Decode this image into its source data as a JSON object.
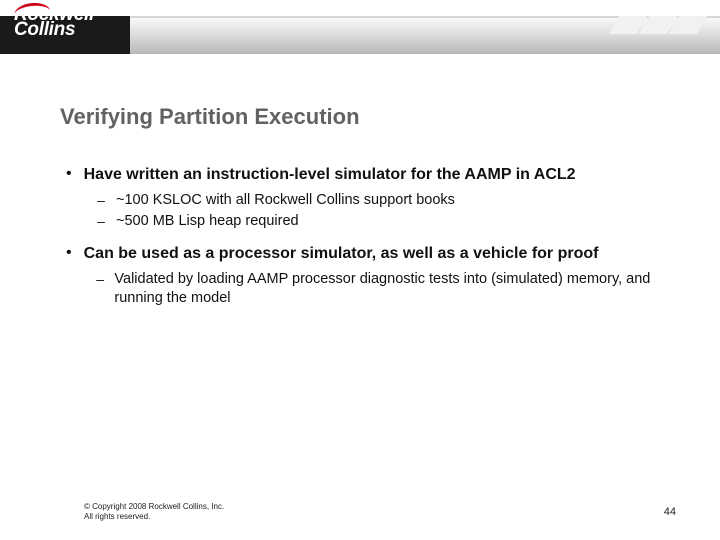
{
  "brand": {
    "name_top": "Rockwell",
    "name_bottom": "Collins",
    "registered": "®"
  },
  "slide": {
    "title": "Verifying Partition Execution",
    "bullets": [
      {
        "text": "Have written an instruction-level simulator for the AAMP in ACL2",
        "subs": [
          "~100 KSLOC with all Rockwell Collins support books",
          "~500 MB Lisp heap required"
        ]
      },
      {
        "text": "Can be used as a processor simulator, as well as a vehicle for proof",
        "subs": [
          "Validated by loading AAMP processor diagnostic tests into (simulated) memory, and running the model"
        ]
      }
    ]
  },
  "footer": {
    "line1": "© Copyright 2008 Rockwell Collins, Inc.",
    "line2": "All rights reserved.",
    "page": "44"
  }
}
